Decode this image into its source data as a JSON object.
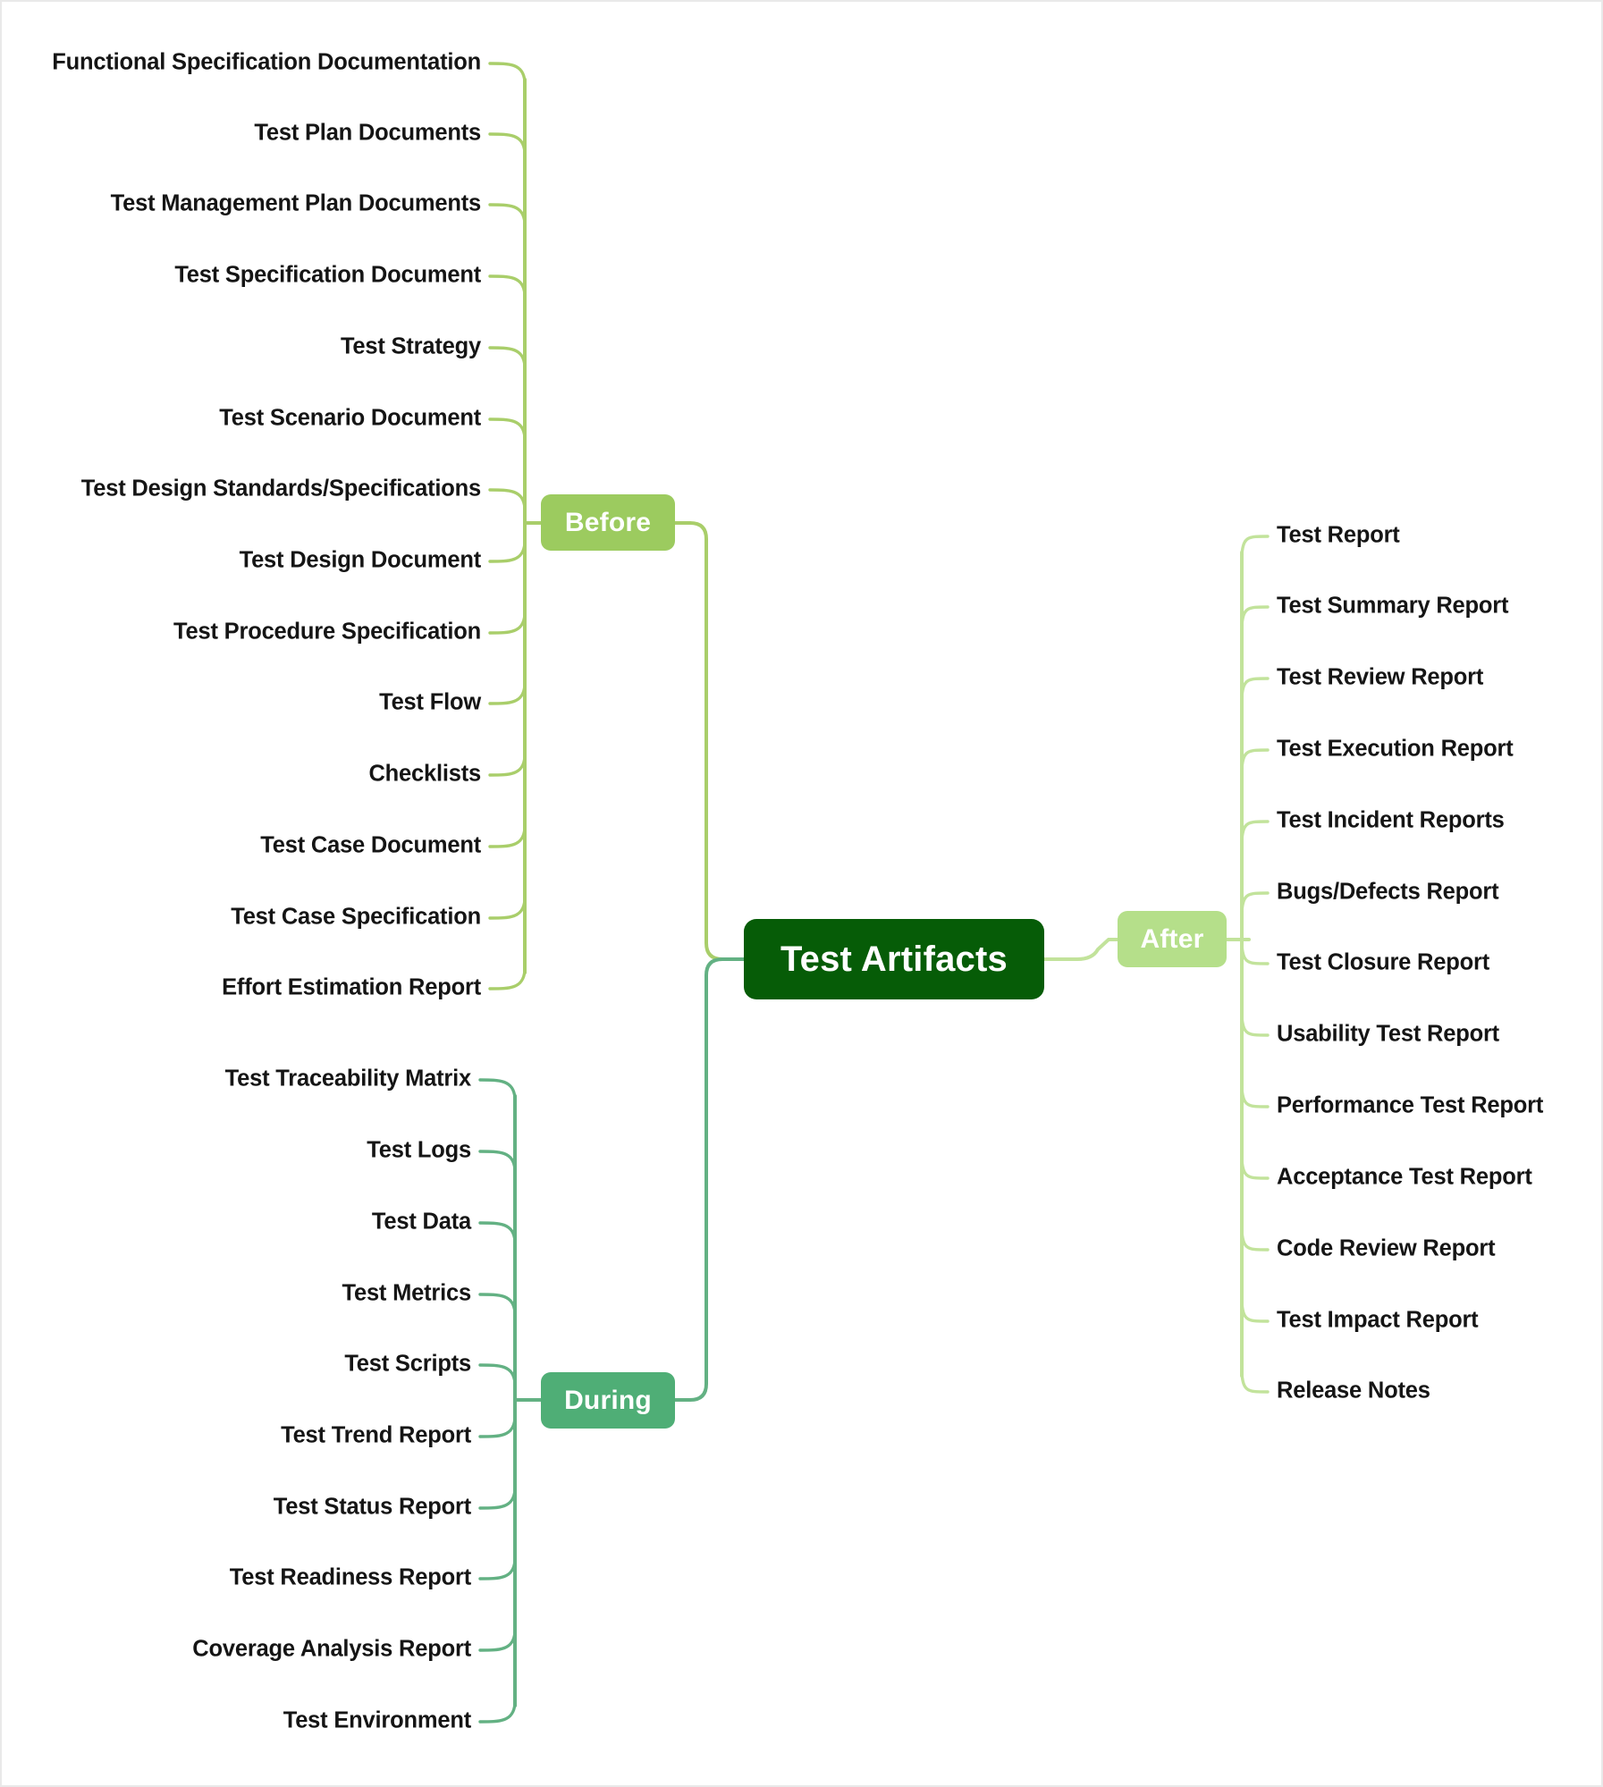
{
  "diagram": {
    "title": "Test Artifacts",
    "type": "mind-map",
    "root": {
      "label": "Test Artifacts",
      "color": "#065c07",
      "text_color": "#ffffff"
    },
    "branches": [
      {
        "id": "before",
        "label": "Before",
        "color": "#9ccb5f",
        "line_color": "#a9ce6a",
        "text_color": "#ffffff",
        "side": "left",
        "items": [
          "Functional Specification Documentation",
          "Test Plan Documents",
          "Test Management Plan Documents",
          "Test Specification Document",
          "Test Strategy",
          "Test Scenario Document",
          "Test Design Standards/Specifications",
          "Test Design Document",
          "Test Procedure Specification",
          "Test Flow",
          "Checklists",
          "Test Case Document",
          "Test Case Specification",
          "Effort Estimation Report"
        ]
      },
      {
        "id": "during",
        "label": "During",
        "color": "#4fae76",
        "line_color": "#63b183",
        "text_color": "#ffffff",
        "side": "left",
        "items": [
          "Test Traceability Matrix",
          "Test Logs",
          "Test Data",
          "Test Metrics",
          "Test Scripts",
          "Test Trend Report",
          "Test Status Report",
          "Test Readiness Report",
          "Coverage Analysis Report",
          "Test Environment"
        ]
      },
      {
        "id": "after",
        "label": "After",
        "color": "#b5df8a",
        "line_color": "#c2e39b",
        "text_color": "#ffffff",
        "side": "right",
        "items": [
          "Test Report",
          "Test Summary Report",
          "Test Review Report",
          "Test Execution Report",
          "Test Incident Reports",
          "Bugs/Defects Report",
          "Test Closure Report",
          "Usability Test Report",
          "Performance Test Report",
          "Acceptance Test Report",
          "Code Review Report",
          "Test Impact Report",
          "Release Notes"
        ]
      }
    ]
  }
}
